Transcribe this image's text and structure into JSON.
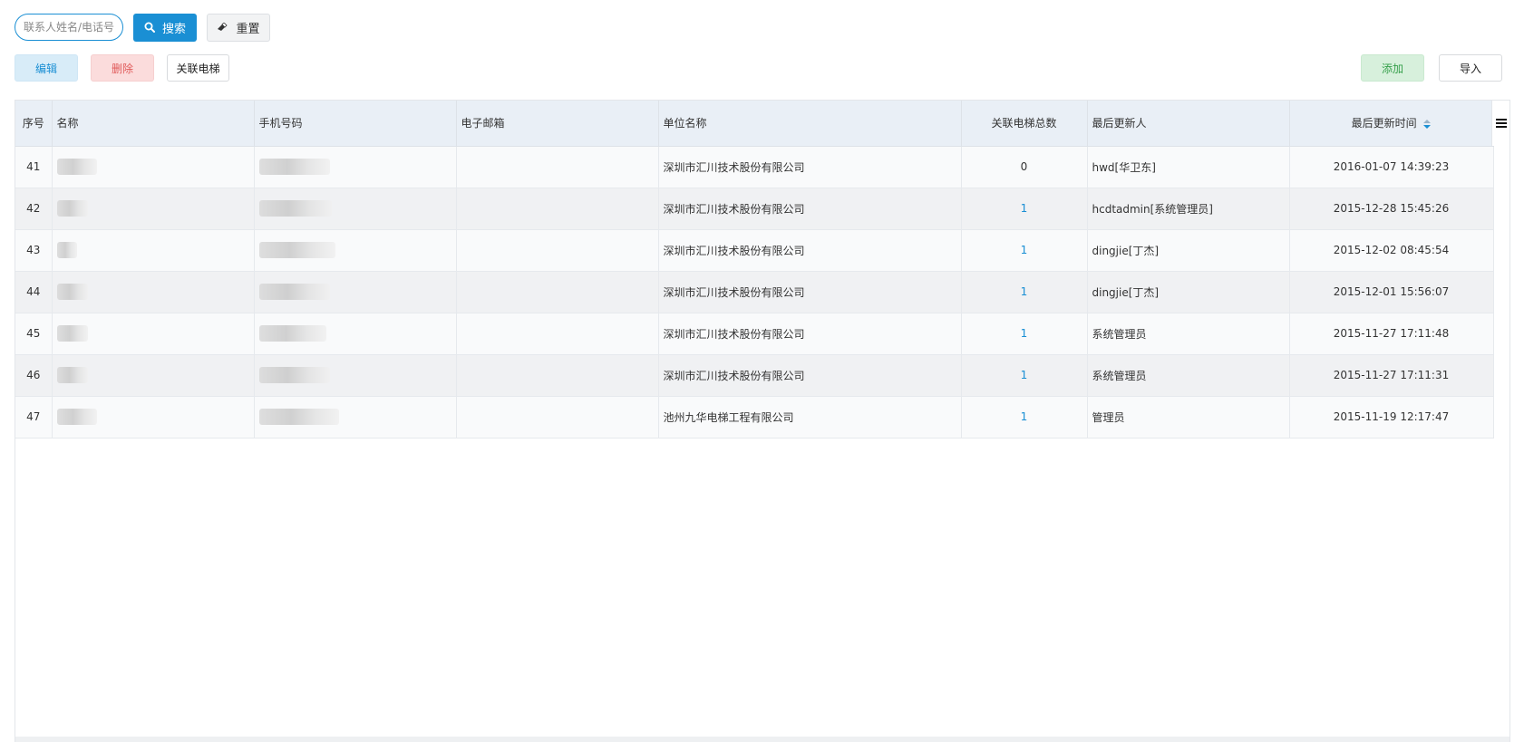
{
  "search": {
    "placeholder": "联系人姓名/电话号",
    "search_label": "搜索",
    "reset_label": "重置"
  },
  "actions": {
    "edit": "编辑",
    "delete": "删除",
    "link_elevator": "关联电梯",
    "add": "添加",
    "import": "导入"
  },
  "table": {
    "columns": {
      "index": "序号",
      "name": "名称",
      "phone": "手机号码",
      "email": "电子邮箱",
      "company": "单位名称",
      "elevator_count": "关联电梯总数",
      "updater": "最后更新人",
      "updated_at": "最后更新时间"
    },
    "rows": [
      {
        "index": "41",
        "company": "深圳市汇川技术股份有限公司",
        "elevator_count": "0",
        "updater": "hwd[华卫东]",
        "updated_at": "2016-01-07 14:39:23"
      },
      {
        "index": "42",
        "company": "深圳市汇川技术股份有限公司",
        "elevator_count": "1",
        "updater": "hcdtadmin[系统管理员]",
        "updated_at": "2015-12-28 15:45:26"
      },
      {
        "index": "43",
        "company": "深圳市汇川技术股份有限公司",
        "elevator_count": "1",
        "updater": "dingjie[丁杰]",
        "updated_at": "2015-12-02 08:45:54"
      },
      {
        "index": "44",
        "company": "深圳市汇川技术股份有限公司",
        "elevator_count": "1",
        "updater": "dingjie[丁杰]",
        "updated_at": "2015-12-01 15:56:07"
      },
      {
        "index": "45",
        "company": "深圳市汇川技术股份有限公司",
        "elevator_count": "1",
        "updater": "系统管理员",
        "updated_at": "2015-11-27 17:11:48"
      },
      {
        "index": "46",
        "company": "深圳市汇川技术股份有限公司",
        "elevator_count": "1",
        "updater": "系统管理员",
        "updated_at": "2015-11-27 17:11:31"
      },
      {
        "index": "47",
        "company": "池州九华电梯工程有限公司",
        "elevator_count": "1",
        "updater": "管理员",
        "updated_at": "2015-11-19 12:17:47"
      }
    ]
  },
  "icons": {
    "search": "search-icon",
    "reset": "eraser-icon",
    "sort": "sort-icon",
    "menu": "hamburger-menu-icon"
  },
  "colors": {
    "primary": "#1a8fd4",
    "danger": "#e05a5a",
    "success": "#36a04b",
    "header_bg": "#e9eff6"
  }
}
